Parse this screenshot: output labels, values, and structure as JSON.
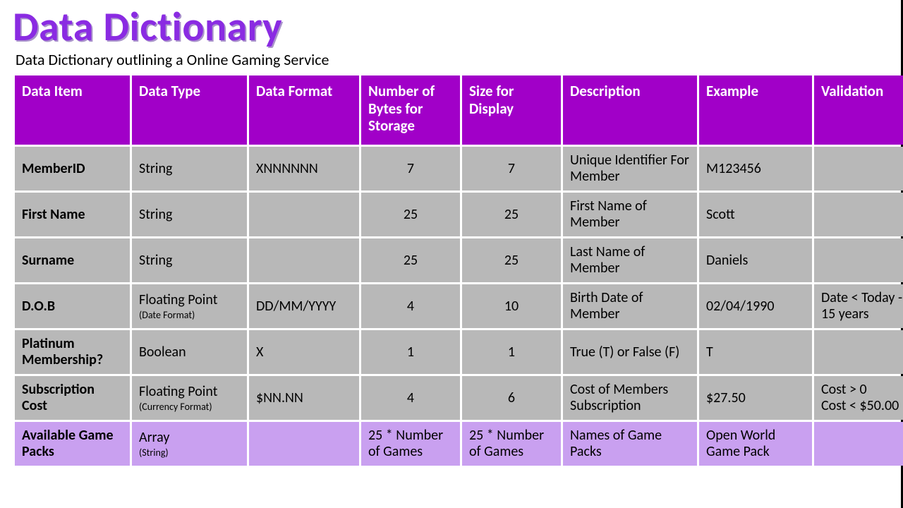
{
  "title": "Data Dictionary",
  "subtitle": "Data Dictionary outlining a Online Gaming Service",
  "headers": {
    "c1": "Data Item",
    "c2": "Data Type",
    "c3": "Data Format",
    "c4": "Number of Bytes for Storage",
    "c5": "Size for Display",
    "c6": "Description",
    "c7": "Example",
    "c8": "Validation"
  },
  "rows": [
    {
      "item": "MemberID",
      "type": "String",
      "type_note": "",
      "format": "XNNNNNN",
      "bytes": "7",
      "display": "7",
      "desc": "Unique Identifier For Member",
      "example": "M123456",
      "validation": ""
    },
    {
      "item": "First Name",
      "type": "String",
      "type_note": "",
      "format": "",
      "bytes": "25",
      "display": "25",
      "desc": "First Name of Member",
      "example": "Scott",
      "validation": ""
    },
    {
      "item": "Surname",
      "type": "String",
      "type_note": "",
      "format": "",
      "bytes": "25",
      "display": "25",
      "desc": "Last Name of Member",
      "example": "Daniels",
      "validation": ""
    },
    {
      "item": "D.O.B",
      "type": "Floating Point",
      "type_note": "(Date Format)",
      "format": "DD/MM/YYYY",
      "bytes": "4",
      "display": "10",
      "desc": "Birth Date of Member",
      "example": "02/04/1990",
      "validation": "Date < Today - 15 years"
    },
    {
      "item": "Platinum Membership?",
      "type": "Boolean",
      "type_note": "",
      "format": "X",
      "bytes": "1",
      "display": "1",
      "desc": "True (T) or False (F)",
      "example": "T",
      "validation": ""
    },
    {
      "item": "Subscription Cost",
      "type": "Floating Point",
      "type_note": "(Currency Format)",
      "format": "$NN.NN",
      "bytes": "4",
      "display": "6",
      "desc": "Cost of Members Subscription",
      "example": "$27.50",
      "validation": "Cost > 0\nCost < $50.00"
    },
    {
      "item": "Available Game Packs",
      "type": "Array",
      "type_note": "(String)",
      "format": "",
      "bytes": "25 * Number of Games",
      "display": "25 * Number of Games",
      "desc": "Names of Game Packs",
      "example": "Open World Game Pack",
      "validation": ""
    }
  ]
}
